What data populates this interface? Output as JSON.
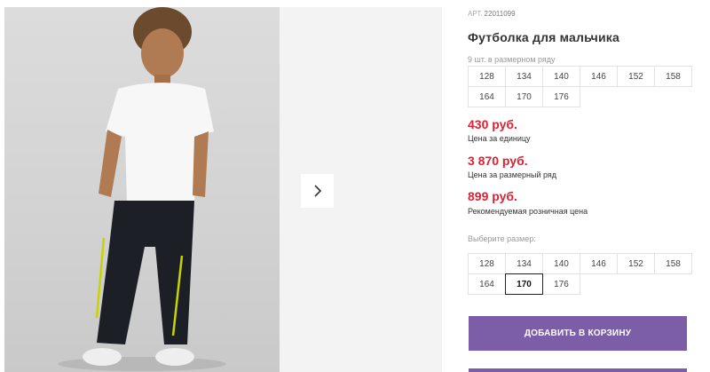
{
  "product": {
    "art_label": "АРТ.",
    "art_number": "22011099",
    "title": "Футболка для мальчика",
    "row_count": "9 шт. в размерном ряду"
  },
  "sizes_row": [
    "128",
    "134",
    "140",
    "146",
    "152",
    "158",
    "164",
    "170",
    "176"
  ],
  "prices": {
    "unit_price": "430 руб.",
    "unit_label": "Цена за единицу",
    "row_price": "3 870 руб.",
    "row_label": "Цена за размерный ряд",
    "retail_price": "899 руб.",
    "retail_label": "Рекомендуемая розничная цена"
  },
  "size_select": {
    "label": "Выберите размер:",
    "options": [
      "128",
      "134",
      "140",
      "146",
      "152",
      "158",
      "164",
      "170",
      "176"
    ],
    "selected": "170"
  },
  "cart": {
    "button_label": "Добавить в корзину"
  },
  "colors": {
    "accent": "#7b5ea7",
    "price": "#e02032"
  },
  "icons": {
    "next": "chevron-right-icon"
  }
}
